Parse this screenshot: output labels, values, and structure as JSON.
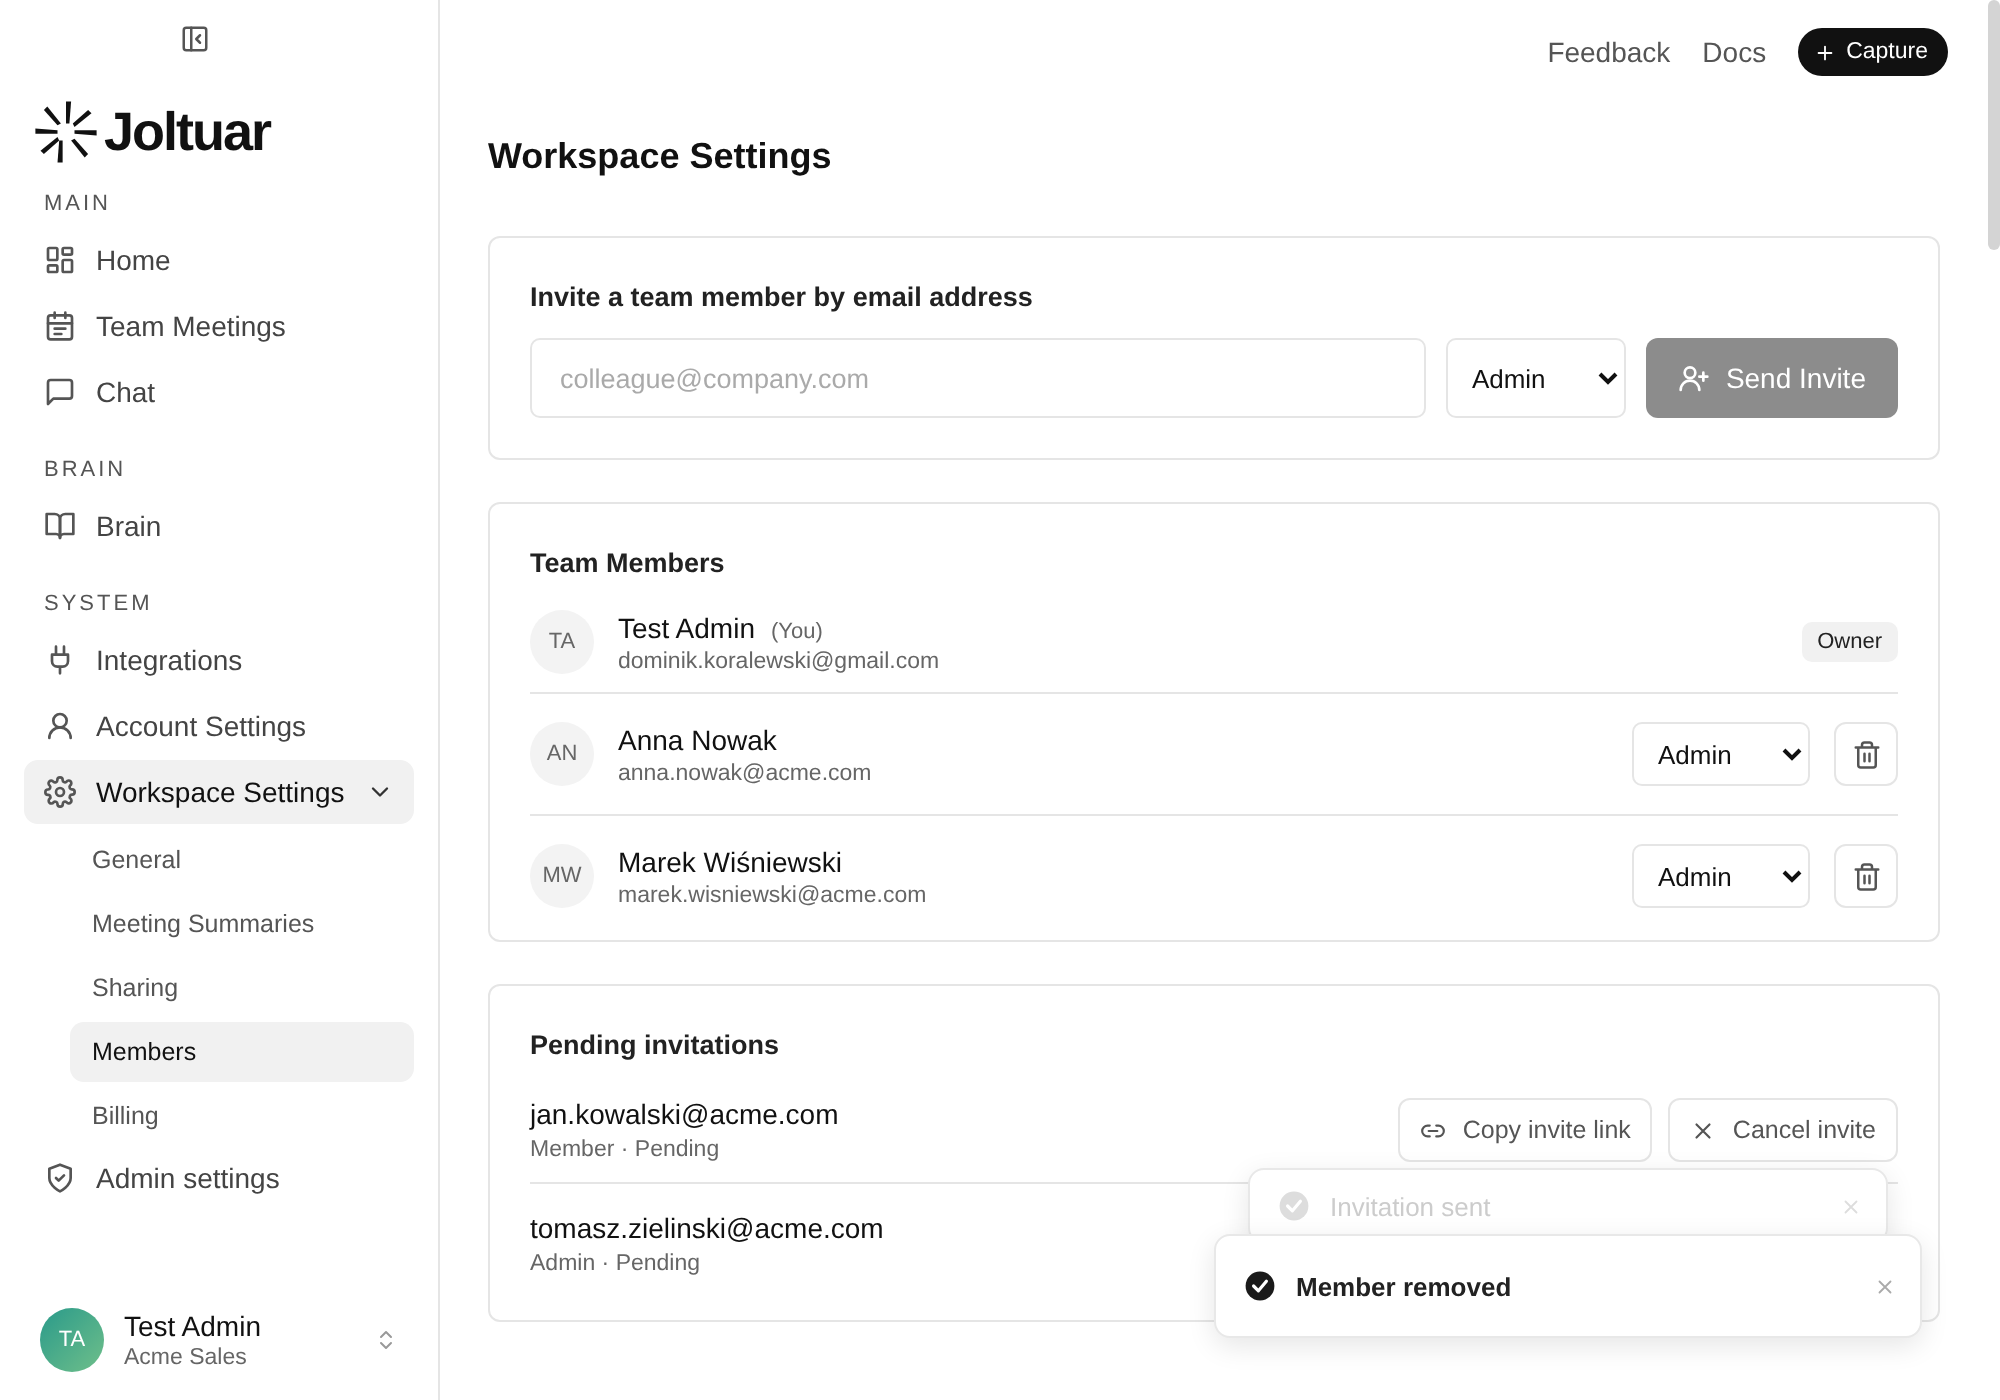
{
  "top_bar": {
    "links": [
      "Feedback",
      "Docs"
    ],
    "capture_button": "Capture"
  },
  "sidebar": {
    "logo": "Joltuar",
    "sections": [
      {
        "heading": "MAIN",
        "items": [
          {
            "label": "Home",
            "selected": false
          },
          {
            "label": "Team Meetings",
            "selected": false
          },
          {
            "label": "Chat",
            "selected": false
          }
        ]
      },
      {
        "heading": "BRAIN",
        "items": [
          {
            "label": "Brain",
            "selected": false
          }
        ]
      },
      {
        "heading": "SYSTEM",
        "items": [
          {
            "label": "Integrations",
            "selected": false
          },
          {
            "label": "Account Settings",
            "selected": false
          },
          {
            "label": "Workspace Settings",
            "selected": true,
            "expanded": true,
            "children": [
              {
                "label": "General",
                "selected": false
              },
              {
                "label": "Meeting Summaries",
                "selected": false
              },
              {
                "label": "Sharing",
                "selected": false
              },
              {
                "label": "Members",
                "selected": true
              },
              {
                "label": "Billing",
                "selected": false
              }
            ]
          },
          {
            "label": "Admin settings",
            "selected": false
          }
        ]
      }
    ],
    "user": {
      "initials": "TA",
      "name": "Test Admin",
      "org": "Acme Sales"
    }
  },
  "page_title": "Workspace Settings",
  "invite": {
    "heading": "Invite a team member by email address",
    "placeholder": "colleague@company.com",
    "role": "Admin",
    "button": {
      "label": "Send Invite",
      "disabled": true
    }
  },
  "team": {
    "heading": "Team Members",
    "members": [
      {
        "kind": "owner",
        "initials": "TA",
        "name": "Test Admin",
        "you_tag": "(You)",
        "email": "dominik.koralewski@gmail.com",
        "badge": "Owner"
      },
      {
        "kind": "editable",
        "initials": "AN",
        "name": "Anna Nowak",
        "email": "anna.nowak@acme.com",
        "role": "Admin"
      },
      {
        "kind": "editable",
        "initials": "MW",
        "name": "Marek Wiśniewski",
        "email": "marek.wisniewski@acme.com",
        "role": "Admin"
      }
    ]
  },
  "pending": {
    "heading": "Pending invitations",
    "invitations": [
      {
        "email": "jan.kowalski@acme.com",
        "details": "Member · Pending",
        "actions": [
          "Copy invite link",
          "Cancel invite"
        ]
      },
      {
        "email": "tomasz.zielinski@acme.com",
        "details": "Admin · Pending"
      }
    ]
  },
  "toasts": [
    {
      "kind": "behind",
      "message": "Invitation sent"
    },
    {
      "kind": "front",
      "message": "Member removed"
    }
  ]
}
